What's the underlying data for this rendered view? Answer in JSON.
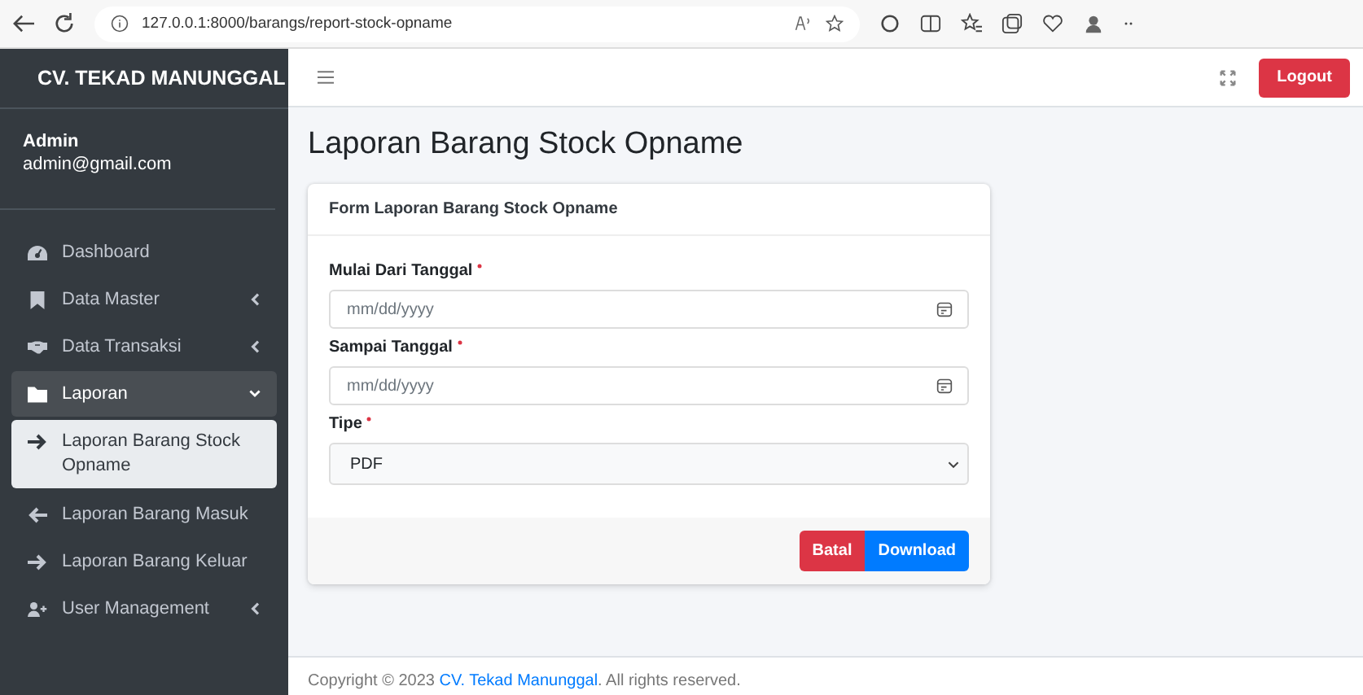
{
  "browser": {
    "url": "127.0.0.1:8000/barangs/report-stock-opname"
  },
  "sidebar": {
    "brand": "CV. TEKAD MANUNGGAL",
    "user": {
      "name": "Admin",
      "email": "admin@gmail.com"
    },
    "items": [
      {
        "label": "Dashboard",
        "kind": "link",
        "selected": false
      },
      {
        "label": "Data Master",
        "kind": "menu",
        "selected": false,
        "expanded": false
      },
      {
        "label": "Data Transaksi",
        "kind": "menu",
        "selected": false,
        "expanded": false
      },
      {
        "label": "Laporan",
        "kind": "menu",
        "selected": true,
        "expanded": true,
        "children": [
          {
            "label": "Laporan Barang Stock Opname",
            "selected": true
          },
          {
            "label": "Laporan Barang Masuk",
            "selected": false
          },
          {
            "label": "Laporan Barang Keluar",
            "selected": false
          }
        ]
      },
      {
        "label": "User Management",
        "kind": "menu",
        "selected": false,
        "expanded": false
      }
    ]
  },
  "topbar": {
    "logout": "Logout"
  },
  "page": {
    "title": "Laporan Barang Stock Opname",
    "form": {
      "title": "Form Laporan Barang Stock Opname",
      "fields": [
        {
          "label": "Mulai Dari Tanggal",
          "required": true,
          "kind": "date",
          "placeholder": "mm/dd/yyyy"
        },
        {
          "label": "Sampai Tanggal",
          "required": true,
          "kind": "date",
          "placeholder": "mm/dd/yyyy"
        },
        {
          "label": "Tipe",
          "required": true,
          "kind": "select",
          "value": "PDF"
        }
      ],
      "buttons": [
        {
          "label": "Batal",
          "kind": "danger"
        },
        {
          "label": "Download",
          "kind": "primary"
        }
      ]
    }
  },
  "footer": {
    "before": "Copyright © 2023 ",
    "link": "CV. Tekad Manunggal",
    "after": ". All rights reserved."
  }
}
